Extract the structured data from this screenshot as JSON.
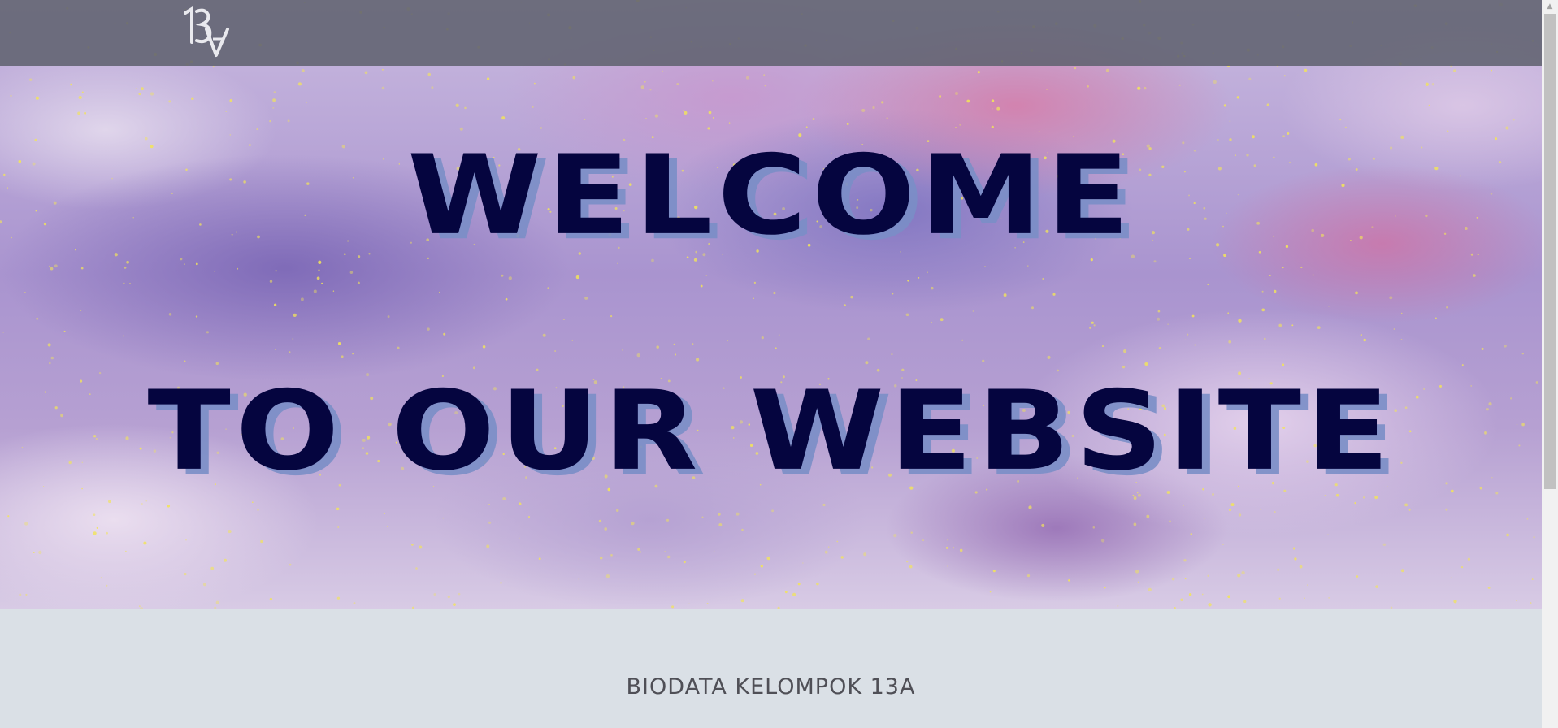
{
  "navbar": {
    "logo_text": "13A"
  },
  "hero": {
    "line_1": "WELCOME",
    "line_2": "TO OUR WEBSITE"
  },
  "section": {
    "heading": "BIODATA KELOMPOK 13A"
  },
  "colors": {
    "navbar": "#606270",
    "hero_text": "#05053f",
    "hero_text_shadow": "#7a8ec6",
    "section_bg": "#dae0e6",
    "section_text": "#4f4f56",
    "star": "#f2e45a"
  },
  "icons": {
    "scroll_up": "triangle-up-icon"
  }
}
